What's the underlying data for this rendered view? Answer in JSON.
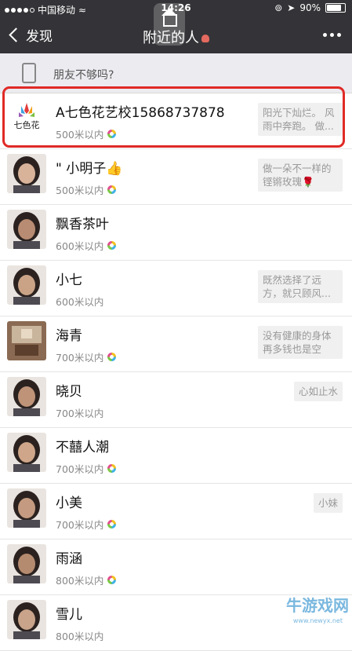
{
  "status_bar": {
    "carrier": "中国移动",
    "time": "14:26",
    "battery": "90%",
    "battery_level": 0.9
  },
  "nav": {
    "back_label": "发现",
    "title": "附近的人"
  },
  "banner": {
    "text": "朋友不够吗?"
  },
  "people": [
    {
      "name": "A七色花艺校15868737878",
      "distance": "500米以内",
      "signature": "阳光下灿烂。 风雨中奔跑。 做...",
      "avatar": "logo-qisehua"
    },
    {
      "name": "\" 小明子👍",
      "distance": "500米以内",
      "signature": "做一朵不一样的铿锵玫瑰🌹",
      "avatar": "woman"
    },
    {
      "name": "飘香茶叶",
      "distance": "600米以内",
      "signature": "",
      "avatar": "woman"
    },
    {
      "name": "小七",
      "distance": "600米以内",
      "signature": "既然选择了远方，就只顾风...",
      "avatar": "woman"
    },
    {
      "name": "海青",
      "distance": "700米以内",
      "signature": "没有健康的身体再多钱也是空",
      "avatar": "room"
    },
    {
      "name": "晓贝",
      "distance": "700米以内",
      "signature": "心如止水",
      "avatar": "woman"
    },
    {
      "name": "不囍人潮",
      "distance": "700米以内",
      "signature": "",
      "avatar": "woman"
    },
    {
      "name": "小美",
      "distance": "700米以内",
      "signature": "小妹",
      "avatar": "woman"
    },
    {
      "name": "雨涵",
      "distance": "800米以内",
      "signature": "",
      "avatar": "woman"
    },
    {
      "name": "雪儿",
      "distance": "800米以内",
      "signature": "",
      "avatar": "woman"
    }
  ],
  "watermark": {
    "text": "牛游戏网",
    "subtext": "www.newyx.net"
  }
}
